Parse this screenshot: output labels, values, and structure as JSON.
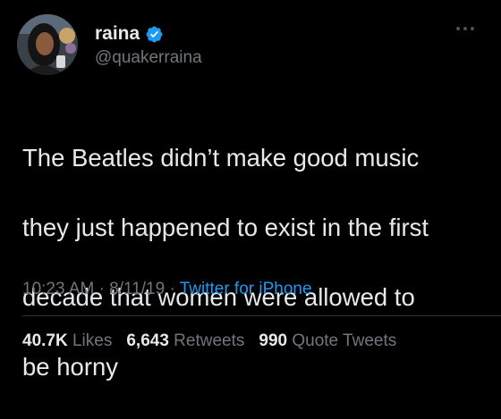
{
  "author": {
    "display_name": "raina",
    "handle": "@quakerraina",
    "verified": true,
    "avatar_icon": "profile-photo"
  },
  "tweet": {
    "text_lines": [
      "The Beatles didn’t make good music",
      "they just happened to exist in the first",
      "decade that women were allowed to",
      "be horny"
    ],
    "time": "10:23 AM",
    "date": "8/11/19",
    "separator": "·",
    "source": "Twitter for iPhone"
  },
  "stats": {
    "likes_count": "40.7K",
    "likes_label": "Likes",
    "retweets_count": "6,643",
    "retweets_label": "Retweets",
    "quotes_count": "990",
    "quotes_label": "Quote Tweets"
  },
  "colors": {
    "background": "#000000",
    "text": "#e7e9ea",
    "secondary": "#71767b",
    "accent": "#1d9bf0"
  },
  "icons": {
    "verified": "verified-badge-icon",
    "more": "more-options-icon"
  }
}
